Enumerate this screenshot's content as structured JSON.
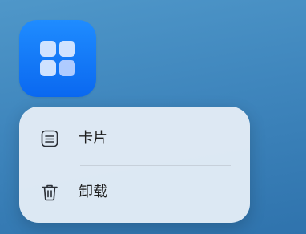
{
  "app": {
    "icon": "widgets-grid-icon",
    "accent_color": "#0a68f0"
  },
  "context_menu": {
    "items": [
      {
        "label": "卡片",
        "icon": "card-icon"
      },
      {
        "label": "卸载",
        "icon": "trash-icon"
      }
    ]
  }
}
